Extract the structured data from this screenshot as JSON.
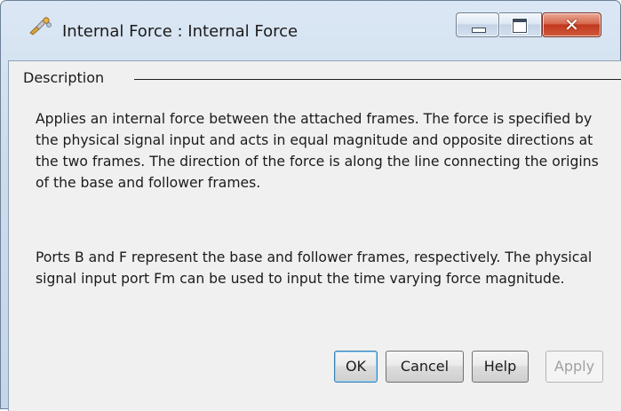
{
  "window": {
    "title": "Internal Force : Internal Force",
    "title_icon": "block-parameters-icon",
    "caption_buttons": {
      "minimize_icon": "minimize-icon",
      "maximize_icon": "maximize-icon",
      "close_icon": "close-icon",
      "close_glyph": "✕"
    },
    "colors": {
      "titlebar": "#cddcec",
      "close_button": "#c0391f",
      "client_background": "#f0f0f0"
    }
  },
  "description": {
    "group_label": "Description",
    "paragraphs": [
      "Applies an internal force between the attached frames. The force is specified by the physical signal input and acts in equal magnitude and opposite directions at the two frames. The direction of the force is along the line connecting the origins of the base and follower frames.",
      "Ports B and F represent the base and follower frames, respectively. The physical signal input port Fm can be used to input the time varying force magnitude."
    ]
  },
  "buttons": {
    "ok": "OK",
    "cancel": "Cancel",
    "help": "Help",
    "apply": "Apply",
    "apply_enabled": false
  }
}
